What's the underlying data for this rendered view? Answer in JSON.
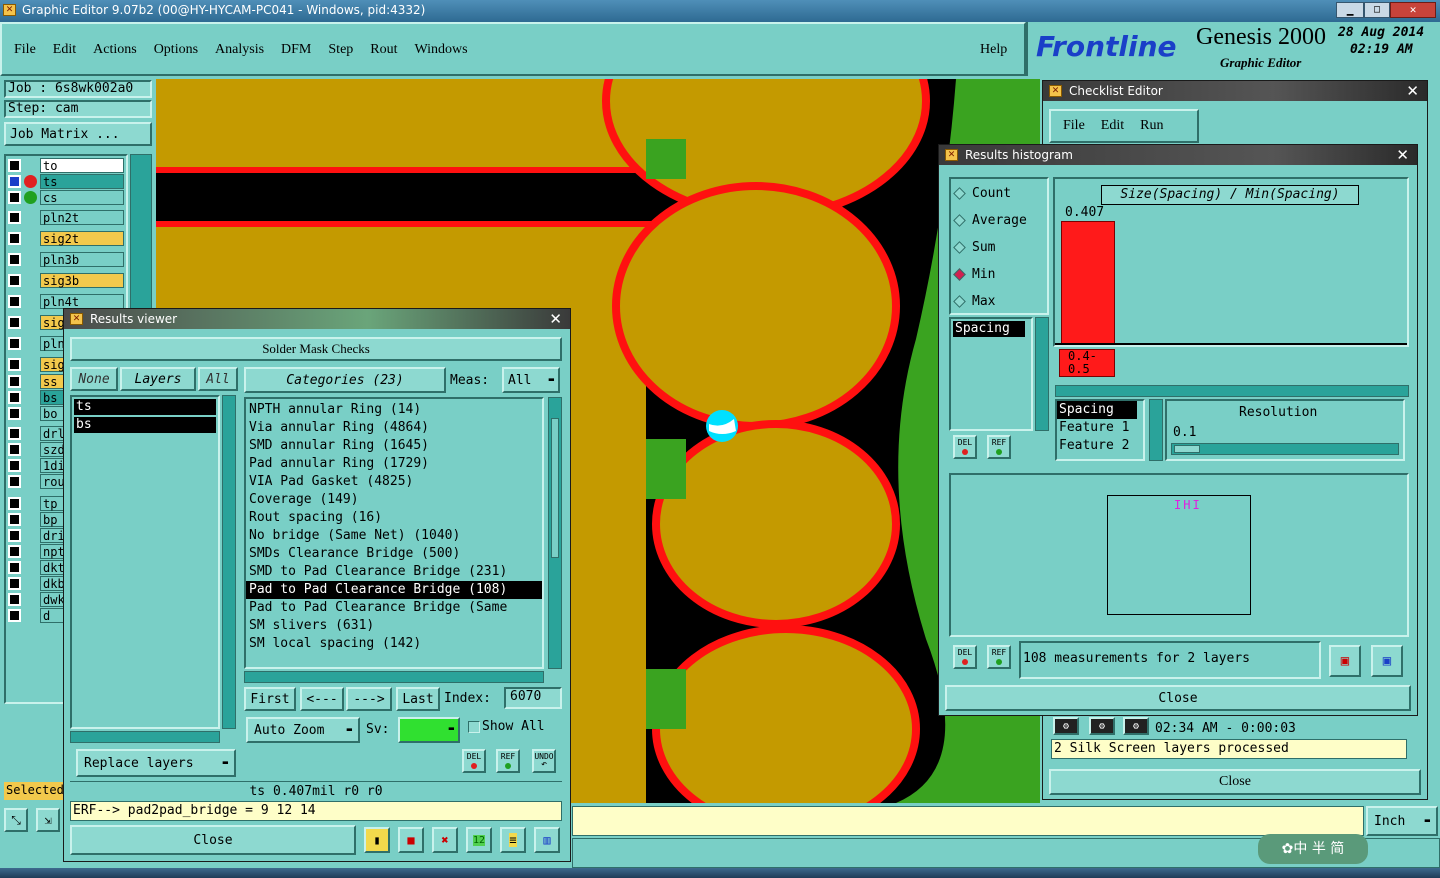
{
  "window": {
    "title": "Graphic Editor 9.07b2 (00@HY-HYCAM-PC041 - Windows, pid:4332)"
  },
  "menubar": {
    "items": [
      "File",
      "Edit",
      "Actions",
      "Options",
      "Analysis",
      "DFM",
      "Step",
      "Rout",
      "Windows"
    ],
    "help": "Help"
  },
  "brand": {
    "logo": "Frontline",
    "product": "Genesis 2000",
    "subtitle": "Graphic Editor",
    "date": "28 Aug 2014",
    "time": "02:19 AM"
  },
  "job": {
    "job_label": "Job  :  6s8wk002a0",
    "step_label": "Step: cam",
    "matrix_button": "Job Matrix ...",
    "selected_label": "Selected"
  },
  "layers": [
    {
      "name": "to",
      "color": "#ffffff"
    },
    {
      "name": "ts",
      "color": "#2aa39a",
      "marker": "#e02020"
    },
    {
      "name": "cs",
      "color": "#79cfc6",
      "marker": "#20a020"
    },
    {
      "name": "pln2t",
      "color": "#79cfc6"
    },
    {
      "name": "sig2t",
      "color": "#f2c94c"
    },
    {
      "name": "pln3b",
      "color": "#79cfc6"
    },
    {
      "name": "sig3b",
      "color": "#f2c94c"
    },
    {
      "name": "pln4t",
      "color": "#79cfc6"
    },
    {
      "name": "sig",
      "color": "#f2c94c"
    },
    {
      "name": "pln",
      "color": "#79cfc6"
    },
    {
      "name": "sig",
      "color": "#f2c94c"
    },
    {
      "name": "ss",
      "color": "#f2c94c"
    },
    {
      "name": "bs",
      "color": "#2aa39a"
    },
    {
      "name": "bo",
      "color": "#79cfc6"
    },
    {
      "name": "drl",
      "color": "#79cfc6"
    },
    {
      "name": "szd",
      "color": "#79cfc6"
    },
    {
      "name": "1di",
      "color": "#79cfc6"
    },
    {
      "name": "rou",
      "color": "#79cfc6"
    },
    {
      "name": "tp",
      "color": "#79cfc6"
    },
    {
      "name": "bp",
      "color": "#79cfc6"
    },
    {
      "name": "dri",
      "color": "#79cfc6"
    },
    {
      "name": "npt",
      "color": "#79cfc6"
    },
    {
      "name": "dkt",
      "color": "#79cfc6"
    },
    {
      "name": "dkb",
      "color": "#79cfc6"
    },
    {
      "name": "dwk",
      "color": "#79cfc6"
    },
    {
      "name": "d",
      "color": "#79cfc6"
    }
  ],
  "results_viewer": {
    "title": "Results viewer",
    "header": "Solder Mask Checks",
    "none_btn": "None",
    "layers_btn": "Layers",
    "all_btn": "All",
    "categories_btn": "Categories (23)",
    "meas_label": "Meas:",
    "meas_value": "All",
    "layer_list": [
      "ts",
      "bs"
    ],
    "categories": [
      "NPTH annular Ring (14)",
      "Via annular Ring (4864)",
      "SMD annular Ring (1645)",
      "Pad annular Ring (1729)",
      "VIA Pad Gasket (4825)",
      "Coverage (149)",
      "Rout spacing (16)",
      "No bridge (Same Net) (1040)",
      "SMDs Clearance Bridge (500)",
      "SMD to Pad Clearance Bridge (231)",
      "Pad to Pad Clearance Bridge (108)",
      "Pad to Pad Clearance Bridge (Same",
      "SM slivers (631)",
      "SM local spacing (142)"
    ],
    "selected_index": 10,
    "first": "First",
    "prev": "<---",
    "next": "--->",
    "last": "Last",
    "index_label": "Index:",
    "index_value": "6070",
    "auto_zoom": "Auto Zoom",
    "sv_label": "Sv:",
    "show_all": "Show All",
    "replace_layers": "Replace layers",
    "del": "DEL",
    "ref": "REF",
    "undo": "UNDO",
    "status": "ts 0.407mil   r0   r0",
    "erf": "ERF--> pad2pad_bridge = 9 12 14",
    "close": "Close"
  },
  "checklist_editor": {
    "title": "Checklist Editor",
    "menu": [
      "File",
      "Edit",
      "Run"
    ],
    "time": "02:34 AM - 0:00:03",
    "message": "2 Silk Screen layers processed",
    "close": "Close"
  },
  "histogram": {
    "title": "Results histogram",
    "modes": [
      {
        "label": "Count",
        "selected": false
      },
      {
        "label": "Average",
        "selected": false
      },
      {
        "label": "Sum",
        "selected": false
      },
      {
        "label": "Min",
        "selected": true
      },
      {
        "label": "Max",
        "selected": false
      }
    ],
    "chart_title": "Size(Spacing) / Min(Spacing)",
    "bar_value": "0.407",
    "range_label": "0.4-\n0.5",
    "spacing_list": [
      "Spacing"
    ],
    "field_list": [
      "Spacing",
      "Feature 1",
      "Feature 2"
    ],
    "resolution_label": "Resolution",
    "resolution_value": "0.1",
    "measurements": "108 measurements for 2 layers",
    "del": "DEL",
    "ref": "REF",
    "close": "Close"
  },
  "bottom": {
    "unit": "Inch",
    "ime": "中 半 简"
  },
  "colors": {
    "teal": "#79cfc6",
    "copper": "#c49a00",
    "mask_red": "#ff1010",
    "board_green": "#3aa320",
    "title_dark": "#3a3a3a"
  }
}
